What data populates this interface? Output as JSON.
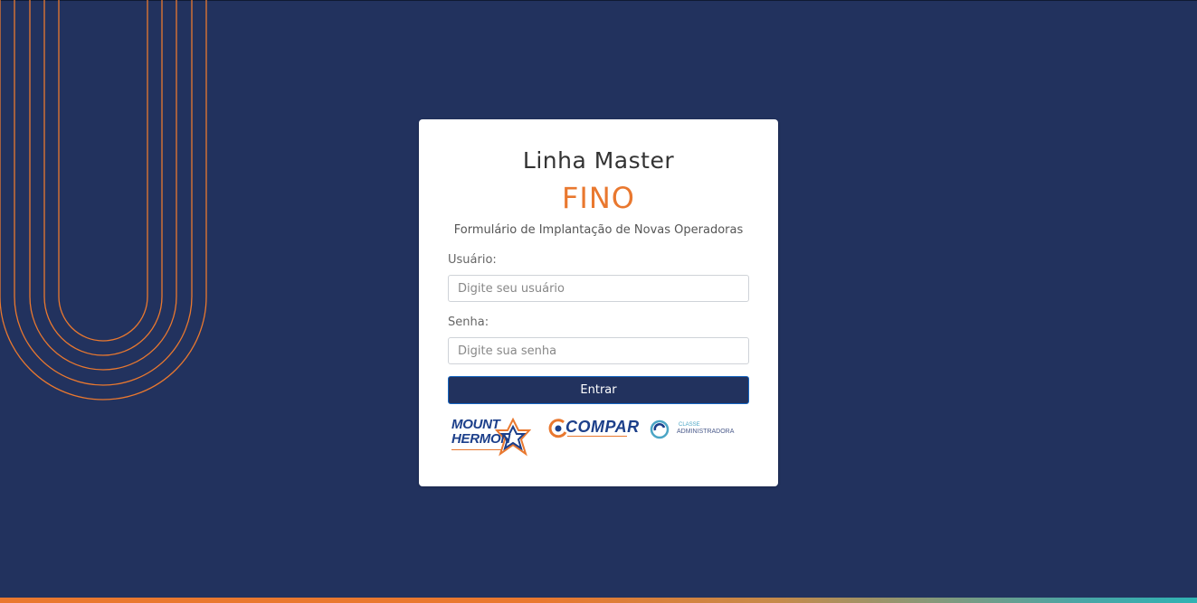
{
  "header": {
    "title": "Linha Master",
    "subtitle": "FINO",
    "description": "Formulário de Implantação de Novas Operadoras"
  },
  "form": {
    "username_label": "Usuário:",
    "username_placeholder": "Digite seu usuário",
    "password_label": "Senha:",
    "password_placeholder": "Digite sua senha",
    "submit_label": "Entrar"
  },
  "logos": {
    "mount_hermon_line1": "MOUNT",
    "mount_hermon_line2": "HERMON",
    "compar": "COMPAR",
    "classe_top": "CLASSE",
    "classe_bottom": "ADMINISTRADORA"
  },
  "colors": {
    "background": "#22325e",
    "accent": "#e9782f",
    "button": "#22325e",
    "card": "#ffffff"
  }
}
